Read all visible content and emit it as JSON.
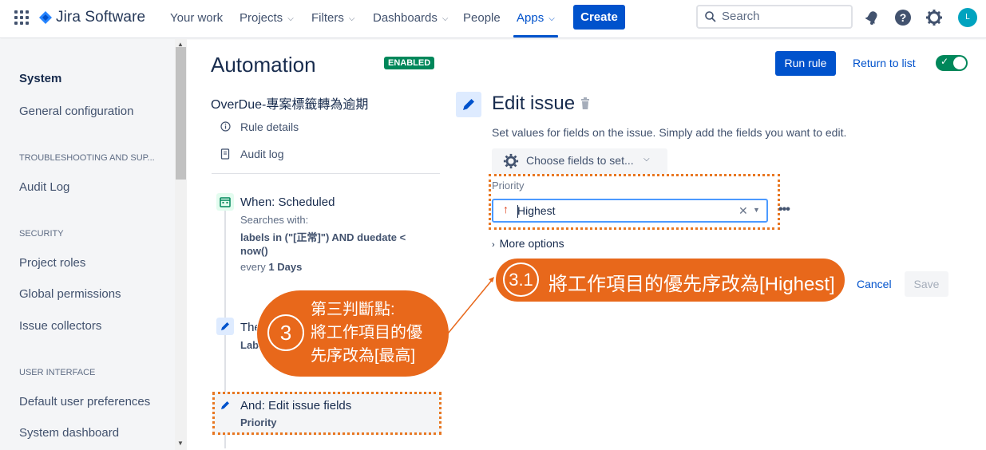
{
  "topnav": {
    "app_name": "Jira Software",
    "items": [
      {
        "label": "Your work",
        "chevron": false
      },
      {
        "label": "Projects",
        "chevron": true
      },
      {
        "label": "Filters",
        "chevron": true
      },
      {
        "label": "Dashboards",
        "chevron": true
      },
      {
        "label": "People",
        "chevron": false
      },
      {
        "label": "Apps",
        "chevron": true,
        "active": true
      }
    ],
    "create_label": "Create",
    "search_placeholder": "Search",
    "avatar_initial": "L",
    "icons": [
      "notifications-icon",
      "help-icon",
      "settings-icon"
    ]
  },
  "sidebar": {
    "items": [
      {
        "type": "item",
        "label": "System",
        "bold": true
      },
      {
        "type": "item",
        "label": "General configuration"
      },
      {
        "type": "heading",
        "label": "TROUBLESHOOTING AND SUP..."
      },
      {
        "type": "item",
        "label": "Audit Log"
      },
      {
        "type": "heading",
        "label": "SECURITY"
      },
      {
        "type": "item",
        "label": "Project roles"
      },
      {
        "type": "item",
        "label": "Global permissions"
      },
      {
        "type": "item",
        "label": "Issue collectors"
      },
      {
        "type": "heading",
        "label": "USER INTERFACE"
      },
      {
        "type": "item",
        "label": "Default user preferences"
      },
      {
        "type": "item",
        "label": "System dashboard"
      }
    ]
  },
  "main": {
    "title": "Automation",
    "status_badge": "ENABLED",
    "run_rule_label": "Run rule",
    "return_label": "Return to list",
    "rule_name": "OverDue-專案標籤轉為逾期",
    "rule_links": [
      "Rule details",
      "Audit log"
    ],
    "steps": {
      "when": {
        "title": "When: Scheduled",
        "searches_with": "Searches with:",
        "jql_line1": "labels in (\"[正常]\") AND duedate <",
        "jql_line2": "now()",
        "every_prefix": "every",
        "every_value": "1 Days"
      },
      "then": {
        "title_fragment": "The",
        "sub_fragment": "Lab"
      },
      "and": {
        "title": "And: Edit issue fields",
        "sub": "Priority"
      }
    }
  },
  "editor": {
    "title": "Edit issue",
    "description": "Set values for fields on the issue. Simply add the fields you want to edit.",
    "choose_fields_label": "Choose fields to set...",
    "priority_label": "Priority",
    "priority_value": "Highest",
    "more_options_label": "More options",
    "cancel_label": "Cancel",
    "save_label": "Save"
  },
  "annotations": {
    "callout_3": {
      "number": "3",
      "lines": [
        "第三判斷點:",
        "將工作項目的優",
        "先序改為[最高]"
      ]
    },
    "callout_3_1": {
      "number": "3.1",
      "text": "將工作項目的優先序改為[Highest]"
    },
    "accent_color": "#e8681b"
  },
  "colors": {
    "brand": "#0052cc",
    "enabled_green": "#00875a",
    "priority_highest": "#de350b"
  }
}
